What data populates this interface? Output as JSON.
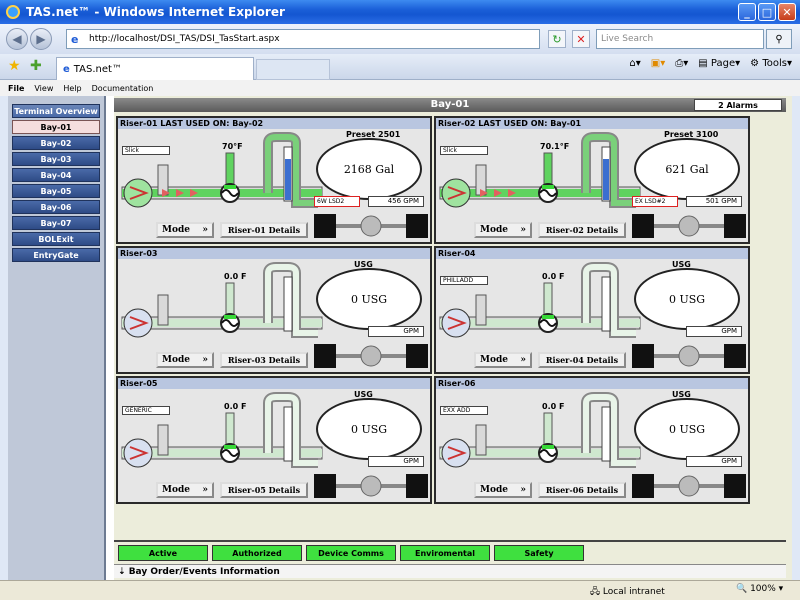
{
  "window": {
    "title": "TAS.net™ - Windows Internet Explorer"
  },
  "address": {
    "url": "http://localhost/DSI_TAS/DSI_TasStart.aspx",
    "search_placeholder": "Live Search"
  },
  "tab": {
    "label": "TAS.net™"
  },
  "commands": {
    "page": "Page",
    "tools": "Tools"
  },
  "menu": [
    "File",
    "View",
    "Help",
    "Documentation"
  ],
  "nav": {
    "header": "Terminal Overview",
    "items": [
      "Bay-01",
      "Bay-02",
      "Bay-03",
      "Bay-04",
      "Bay-05",
      "Bay-06",
      "Bay-07",
      "BOLExit",
      "EntryGate"
    ]
  },
  "bay": {
    "title": "Bay-01",
    "alarms": "2 Alarms"
  },
  "risers": [
    {
      "title": "Riser-01 LAST USED ON: Bay-02",
      "unit": "Preset 2501",
      "volume": "2168 Gal",
      "temp": "70°F",
      "tag": "Slick",
      "flow_tag": "6W LSD2",
      "flow": "456 GPM",
      "mode": "Mode",
      "details": "Riser-01 Details"
    },
    {
      "title": "Riser-02 LAST USED ON: Bay-01",
      "unit": "Preset 3100",
      "volume": "621 Gal",
      "temp": "70.1°F",
      "tag": "Slick",
      "flow_tag": "EX LSD#2",
      "flow": "501 GPM",
      "mode": "Mode",
      "details": "Riser-02 Details"
    },
    {
      "title": "Riser-03",
      "unit": "USG",
      "volume": "0 USG",
      "temp": "0.0 F",
      "tag": "",
      "flow_tag": "",
      "flow": "GPM",
      "mode": "Mode",
      "details": "Riser-03 Details"
    },
    {
      "title": "Riser-04",
      "unit": "USG",
      "volume": "0 USG",
      "temp": "0.0 F",
      "tag": "PHILLADD",
      "flow_tag": "",
      "flow": "GPM",
      "mode": "Mode",
      "details": "Riser-04 Details"
    },
    {
      "title": "Riser-05",
      "unit": "USG",
      "volume": "0 USG",
      "temp": "0.0 F",
      "tag": "GENERIC",
      "flow_tag": "",
      "flow": "GPM",
      "mode": "Mode",
      "details": "Riser-05 Details"
    },
    {
      "title": "Riser-06",
      "unit": "USG",
      "volume": "0 USG",
      "temp": "0.0 F",
      "tag": "EXX ADD",
      "flow_tag": "",
      "flow": "GPM",
      "mode": "Mode",
      "details": "Riser-06 Details"
    }
  ],
  "status_buttons": [
    "Active",
    "Authorized",
    "Device Comms",
    "Enviromental",
    "Safety"
  ],
  "events": {
    "label": "Bay Order/Events Information"
  },
  "ie_status": {
    "zone": "Local intranet",
    "zoom": "100%"
  },
  "colors": {
    "status_ok": "#3fe03f",
    "nav": "#2e4b86",
    "pipe_active": "#5fd35f",
    "header": "#b9c6e0"
  }
}
